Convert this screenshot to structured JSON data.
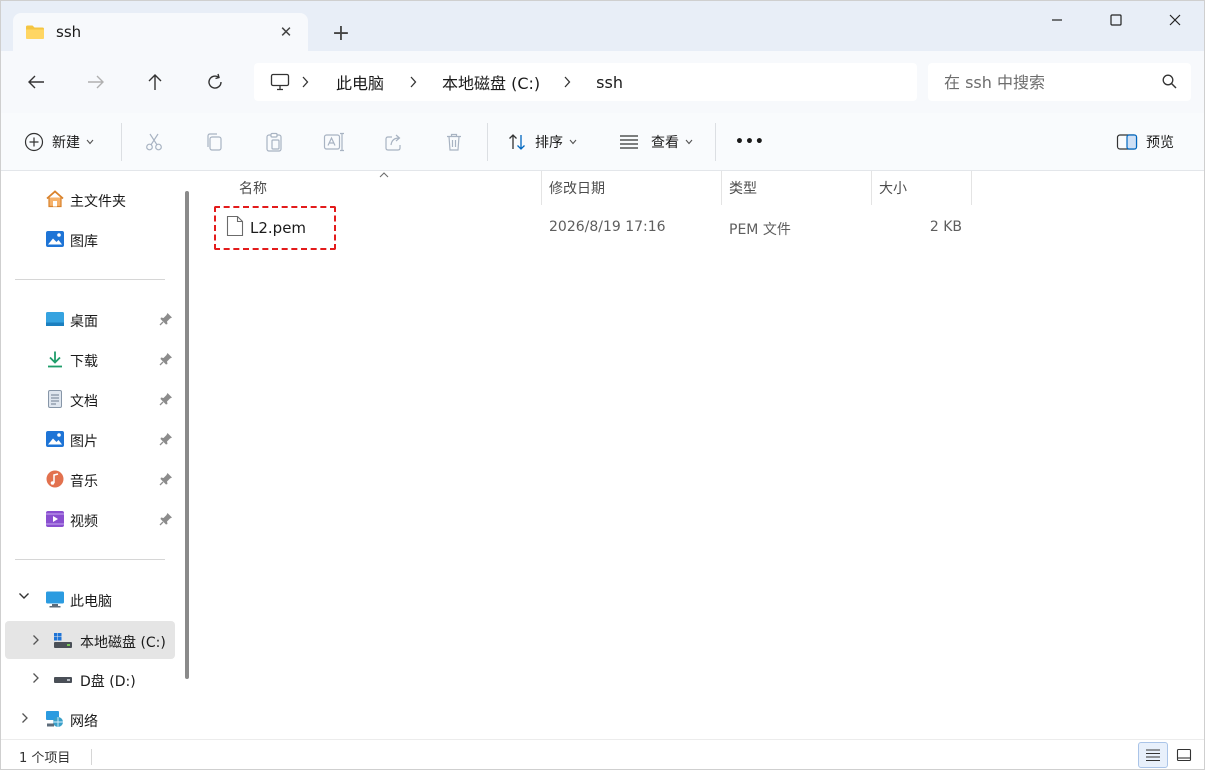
{
  "window": {
    "tab_title": "ssh",
    "tab_close": "✕",
    "new_tab": "+"
  },
  "nav": {
    "breadcrumbs": [
      "此电脑",
      "本地磁盘 (C:)",
      "ssh"
    ],
    "search_placeholder": "在 ssh 中搜索"
  },
  "toolbar": {
    "new_label": "新建",
    "sort_label": "排序",
    "view_label": "查看",
    "more_label": "•••",
    "preview_label": "预览"
  },
  "sidebar": {
    "quick": [
      {
        "label": "主文件夹",
        "icon": "home-icon"
      },
      {
        "label": "图库",
        "icon": "gallery-icon"
      }
    ],
    "pinned": [
      {
        "label": "桌面",
        "icon": "desktop-icon"
      },
      {
        "label": "下载",
        "icon": "download-icon"
      },
      {
        "label": "文档",
        "icon": "document-icon"
      },
      {
        "label": "图片",
        "icon": "pictures-icon"
      },
      {
        "label": "音乐",
        "icon": "music-icon"
      },
      {
        "label": "视频",
        "icon": "video-icon"
      }
    ],
    "tree": [
      {
        "label": "此电脑",
        "icon": "this-pc-icon"
      },
      {
        "label": "本地磁盘 (C:)",
        "icon": "drive-c-icon"
      },
      {
        "label": "D盘 (D:)",
        "icon": "drive-d-icon"
      },
      {
        "label": "网络",
        "icon": "network-icon"
      }
    ]
  },
  "columns": {
    "name": "名称",
    "date": "修改日期",
    "type": "类型",
    "size": "大小"
  },
  "files": [
    {
      "name": "L2.pem",
      "date": "2026/8/19 17:16",
      "type": "PEM 文件",
      "size": "2 KB"
    }
  ],
  "status": {
    "item_count": "1 个项目"
  },
  "colors": {
    "accent": "#0067c0",
    "highlight_border": "#e31b1b",
    "tabstrip_bg": "#e8eef7"
  }
}
